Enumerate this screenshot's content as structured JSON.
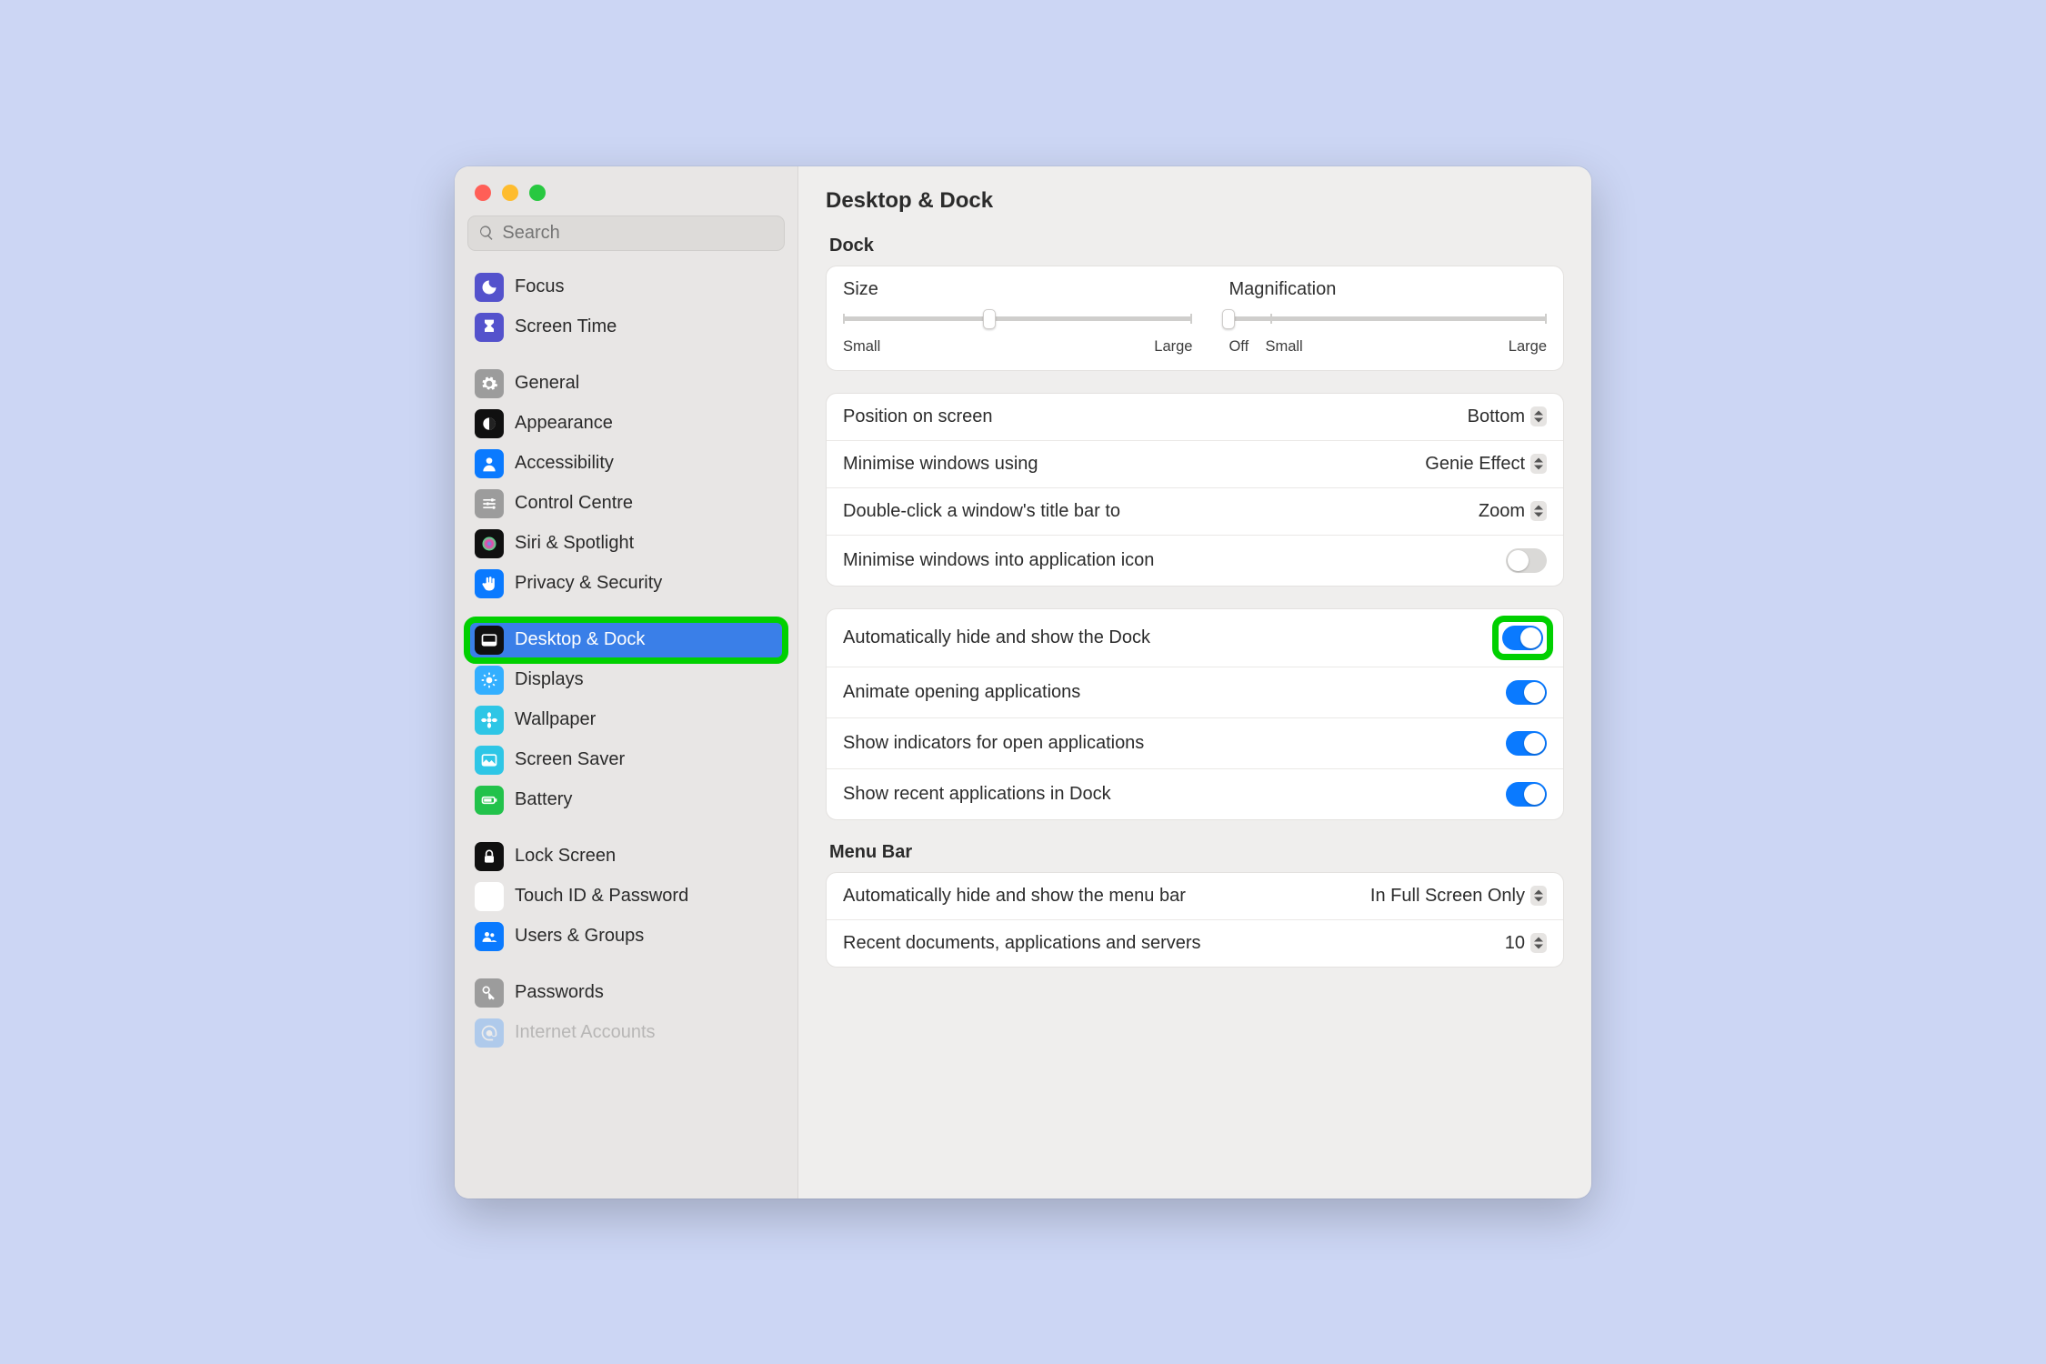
{
  "search_placeholder": "Search",
  "page_title": "Desktop & Dock",
  "sidebar": [
    {
      "group": [
        {
          "id": "focus",
          "label": "Focus",
          "bg": "#5452CC",
          "icon": "moon"
        },
        {
          "id": "screen-time",
          "label": "Screen Time",
          "bg": "#5452CC",
          "icon": "hourglass"
        }
      ]
    },
    {
      "group": [
        {
          "id": "general",
          "label": "General",
          "bg": "#9C9C9C",
          "icon": "gear"
        },
        {
          "id": "appearance",
          "label": "Appearance",
          "bg": "#101010",
          "icon": "appearance"
        },
        {
          "id": "accessibility",
          "label": "Accessibility",
          "bg": "#0A7AFF",
          "icon": "person"
        },
        {
          "id": "control-centre",
          "label": "Control Centre",
          "bg": "#9C9C9C",
          "icon": "sliders"
        },
        {
          "id": "siri",
          "label": "Siri & Spotlight",
          "bg": "#101010",
          "icon": "siri",
          "siri": true
        },
        {
          "id": "privacy",
          "label": "Privacy & Security",
          "bg": "#0A7AFF",
          "icon": "hand"
        }
      ]
    },
    {
      "group": [
        {
          "id": "desktop-dock",
          "label": "Desktop & Dock",
          "bg": "#101010",
          "icon": "dock",
          "selected": true,
          "hl": true
        },
        {
          "id": "displays",
          "label": "Displays",
          "bg": "#33AFFF",
          "icon": "sun"
        },
        {
          "id": "wallpaper",
          "label": "Wallpaper",
          "bg": "#2EC6E6",
          "icon": "flower"
        },
        {
          "id": "screen-saver",
          "label": "Screen Saver",
          "bg": "#2EC6E6",
          "icon": "photo"
        },
        {
          "id": "battery",
          "label": "Battery",
          "bg": "#22C24B",
          "icon": "battery"
        }
      ]
    },
    {
      "group": [
        {
          "id": "lock-screen",
          "label": "Lock Screen",
          "bg": "#101010",
          "icon": "lock"
        },
        {
          "id": "touch-id",
          "label": "Touch ID & Password",
          "bg": "#FFFFFF",
          "icon": "finger",
          "fg": "#E74858"
        },
        {
          "id": "users",
          "label": "Users & Groups",
          "bg": "#0A7AFF",
          "icon": "users"
        }
      ]
    },
    {
      "group": [
        {
          "id": "passwords",
          "label": "Passwords",
          "bg": "#9C9C9C",
          "icon": "key"
        },
        {
          "id": "internet",
          "label": "Internet Accounts",
          "bg": "#0A7AFF",
          "icon": "at",
          "cut": true
        }
      ]
    }
  ],
  "dock": {
    "section": "Dock",
    "size": {
      "label": "Size",
      "min": "Small",
      "max": "Large",
      "value": 42
    },
    "mag": {
      "label": "Magnification",
      "off": "Off",
      "min": "Small",
      "max": "Large",
      "value": 0
    },
    "rows": [
      {
        "id": "position",
        "label": "Position on screen",
        "type": "select",
        "value": "Bottom"
      },
      {
        "id": "min-using",
        "label": "Minimise windows using",
        "type": "select",
        "value": "Genie Effect"
      },
      {
        "id": "dbl-click",
        "label": "Double-click a window's title bar to",
        "type": "select",
        "value": "Zoom"
      },
      {
        "id": "min-into",
        "label": "Minimise windows into application icon",
        "type": "toggle",
        "on": false
      }
    ],
    "rows2": [
      {
        "id": "auto-hide",
        "label": "Automatically hide and show the Dock",
        "type": "toggle",
        "on": true,
        "hl": true
      },
      {
        "id": "animate",
        "label": "Animate opening applications",
        "type": "toggle",
        "on": true
      },
      {
        "id": "indicators",
        "label": "Show indicators for open applications",
        "type": "toggle",
        "on": true
      },
      {
        "id": "recent",
        "label": "Show recent applications in Dock",
        "type": "toggle",
        "on": true
      }
    ]
  },
  "menubar": {
    "section": "Menu Bar",
    "rows": [
      {
        "id": "auto-hide-mb",
        "label": "Automatically hide and show the menu bar",
        "type": "select",
        "value": "In Full Screen Only"
      },
      {
        "id": "recent-docs",
        "label": "Recent documents, applications and servers",
        "type": "select",
        "value": "10"
      }
    ]
  }
}
